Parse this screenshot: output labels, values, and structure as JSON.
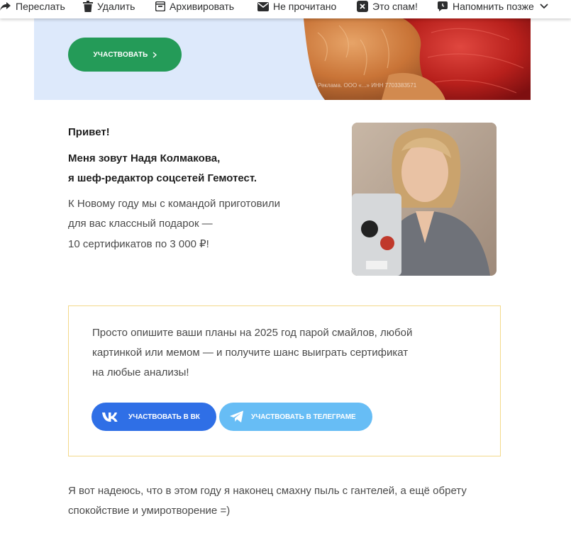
{
  "toolbar": {
    "forward": "Переслать",
    "delete": "Удалить",
    "archive": "Архивировать",
    "unread": "Не прочитано",
    "spam": "Это спам!",
    "remind": "Напомнить позже"
  },
  "banner": {
    "button": "УЧАСТВОВАТЬ",
    "ad_note": "Реклама. ООО «...» ИНН 7703383571"
  },
  "intro": {
    "greeting": "Привет!",
    "line1": "Меня зовут Надя Колмакова,",
    "line2": "я шеф-редактор соцсетей Гемотест.",
    "text1": "К Новому году мы с командой приготовили",
    "text2": "для вас классный подарок —",
    "text3": "10 сертификатов по 3 000 ₽!"
  },
  "contest": {
    "line1": "Просто опишите ваши планы на 2025 год парой смайлов, любой",
    "line2": "картинкой или мемом — и получите шанс выиграть сертификат",
    "line3": "на любые анализы!",
    "vk_button": "УЧАСТВОВАТЬ В ВК",
    "tg_button": "УЧАСТВОВАТЬ В ТЕЛЕГРАМЕ"
  },
  "outro": {
    "line1": "Я вот надеюсь, что в этом году я наконец смахну пыль с гантелей, а ещё обрету",
    "line2": "спокойствие и умиротворение =)"
  },
  "colors": {
    "green_button": "#249b58",
    "vk_blue": "#2f6fe6",
    "telegram_blue": "#67bdf5",
    "banner_bg": "#dde9fb",
    "contest_border": "#f3d98a"
  }
}
